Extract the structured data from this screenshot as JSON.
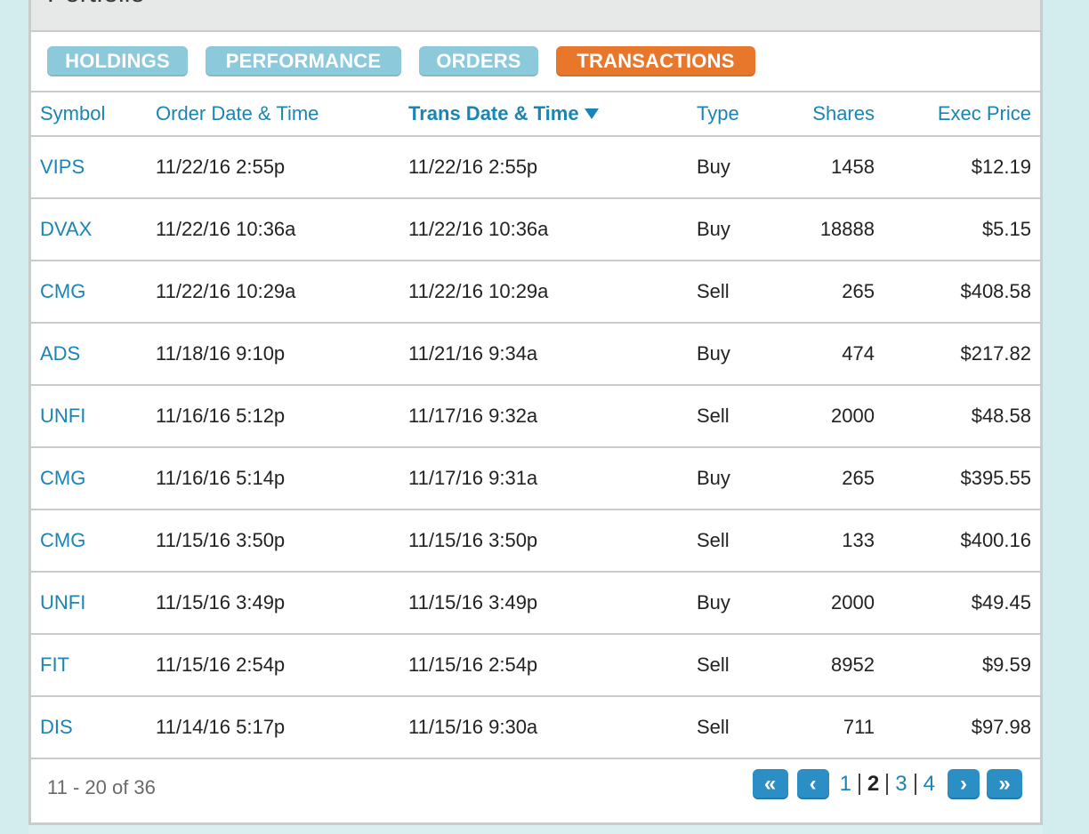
{
  "panel": {
    "title": "Portfolio"
  },
  "tabs": [
    {
      "label": "HOLDINGS",
      "active": false
    },
    {
      "label": "PERFORMANCE",
      "active": false
    },
    {
      "label": "ORDERS",
      "active": false
    },
    {
      "label": "TRANSACTIONS",
      "active": true
    }
  ],
  "table": {
    "columns": [
      "Symbol",
      "Order Date & Time",
      "Trans Date & Time",
      "Type",
      "Shares",
      "Exec Price"
    ],
    "sorted_column": "Trans Date & Time",
    "sort_direction": "descending",
    "rows": [
      {
        "symbol": "VIPS",
        "order": "11/22/16 2:55p",
        "trans": "11/22/16 2:55p",
        "type": "Buy",
        "shares": "1458",
        "price": "$12.19"
      },
      {
        "symbol": "DVAX",
        "order": "11/22/16 10:36a",
        "trans": "11/22/16 10:36a",
        "type": "Buy",
        "shares": "18888",
        "price": "$5.15"
      },
      {
        "symbol": "CMG",
        "order": "11/22/16 10:29a",
        "trans": "11/22/16 10:29a",
        "type": "Sell",
        "shares": "265",
        "price": "$408.58"
      },
      {
        "symbol": "ADS",
        "order": "11/18/16 9:10p",
        "trans": "11/21/16 9:34a",
        "type": "Buy",
        "shares": "474",
        "price": "$217.82"
      },
      {
        "symbol": "UNFI",
        "order": "11/16/16 5:12p",
        "trans": "11/17/16 9:32a",
        "type": "Sell",
        "shares": "2000",
        "price": "$48.58"
      },
      {
        "symbol": "CMG",
        "order": "11/16/16 5:14p",
        "trans": "11/17/16 9:31a",
        "type": "Buy",
        "shares": "265",
        "price": "$395.55"
      },
      {
        "symbol": "CMG",
        "order": "11/15/16 3:50p",
        "trans": "11/15/16 3:50p",
        "type": "Sell",
        "shares": "133",
        "price": "$400.16"
      },
      {
        "symbol": "UNFI",
        "order": "11/15/16 3:49p",
        "trans": "11/15/16 3:49p",
        "type": "Buy",
        "shares": "2000",
        "price": "$49.45"
      },
      {
        "symbol": "FIT",
        "order": "11/15/16 2:54p",
        "trans": "11/15/16 2:54p",
        "type": "Sell",
        "shares": "8952",
        "price": "$9.59"
      },
      {
        "symbol": "DIS",
        "order": "11/14/16 5:17p",
        "trans": "11/15/16 9:30a",
        "type": "Sell",
        "shares": "711",
        "price": "$97.98"
      }
    ]
  },
  "footer": {
    "range_text": "11 - 20 of 36",
    "pager": {
      "first": "«",
      "prev": "‹",
      "pages": [
        "1",
        "2",
        "3",
        "4"
      ],
      "current_page": "2",
      "next": "›",
      "last": "»"
    }
  },
  "colors": {
    "tab_inactive": "#8cc9da",
    "tab_active": "#e8762b",
    "link_blue": "#1a85b4",
    "pager_button": "#2b8fc6"
  }
}
